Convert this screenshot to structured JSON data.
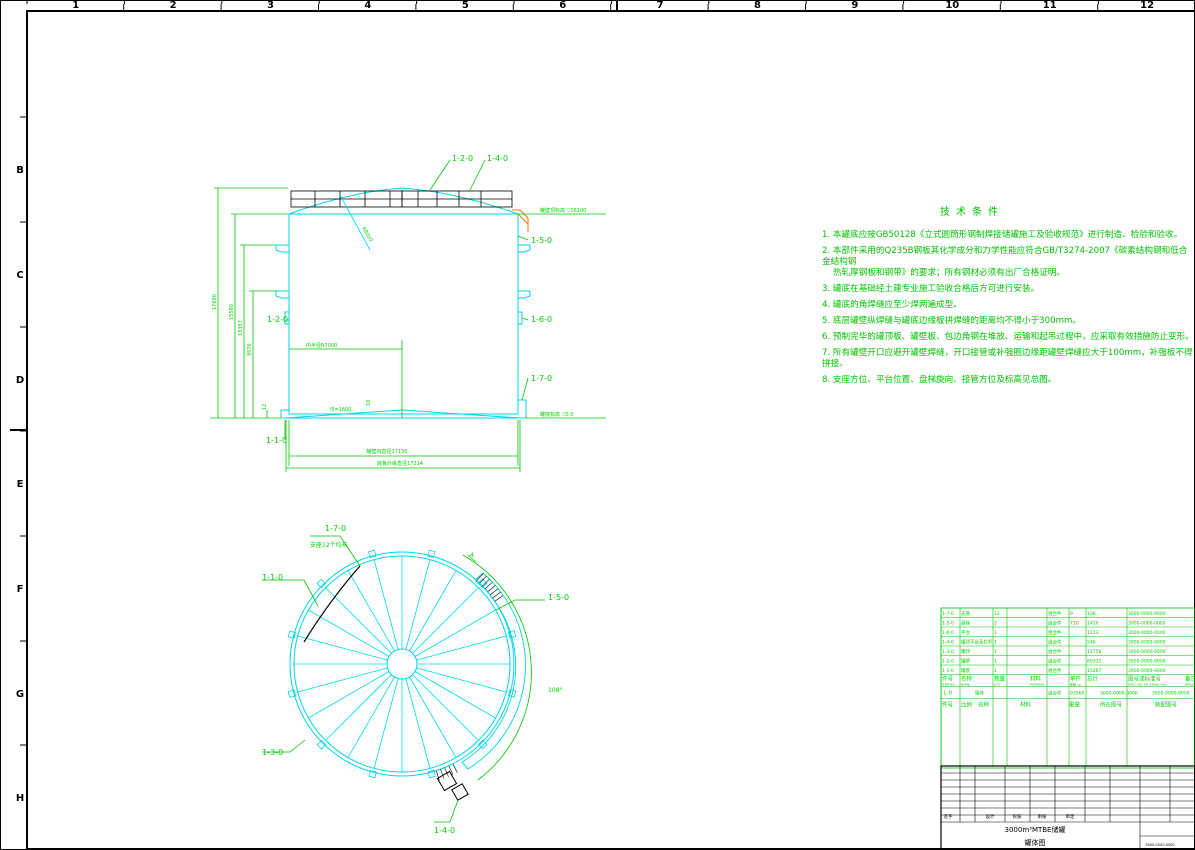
{
  "border": {
    "columns": [
      "1",
      "2",
      "3",
      "4",
      "5",
      "6",
      "7",
      "8",
      "9",
      "10",
      "11",
      "12"
    ],
    "rows": [
      "B",
      "C",
      "D",
      "E",
      "F",
      "G",
      "H"
    ]
  },
  "elevation": {
    "callouts": [
      "1-2-0",
      "1-4-0",
      "1-5-0",
      "1-2-0",
      "1-6-0",
      "1-7-0",
      "1-1-0"
    ],
    "dims": [
      "17690",
      "15580",
      "13357",
      "9576",
      "12"
    ],
    "roof_slope_label": "R8000",
    "inner_radius_label": "内半径R7000",
    "elevation_top": "罐壁顶标高 ▽16100",
    "elevation_bottom": "罐底标高 ▽0.0",
    "bottom_slope": "i5=1600",
    "bottom_slope_small": "10",
    "diameter_inner": "罐壁内直径17150",
    "diameter_outer": "底板外缘直径17214"
  },
  "plan": {
    "callouts": [
      "1-7-0",
      "1-1-0",
      "1-5-0",
      "1-3-0",
      "1-4-0"
    ],
    "lugs_label": "支座12个均布",
    "angle_label": "108°",
    "small_label": "4"
  },
  "notes": {
    "title": "技术条件",
    "items": [
      "1. 本罐底应按GB50128《立式圆筒形钢制焊接储罐施工及验收规范》进行制造、检验和验收。",
      "2. 本部件采用的Q235B钢板其化学成分和力学性能应符合GB/T3274-2007《碳素结构钢和低合金结构钢\n    热轧厚钢板和钢带》的要求；所有钢材必须有出厂合格证明。",
      "3. 罐底在基础经土建专业施工验收合格后方可进行安装。",
      "4. 罐底的角焊缝应至少焊两遍成型。",
      "5. 底层罐壁纵焊缝与罐底边缘板拼焊缝的距离均不得小于300mm。",
      "6. 预制完毕的罐顶板、罐壁板、包边角钢在堆放、运输和起吊过程中，应采取有效措施防止变形。",
      "7. 所有罐壁开口应避开罐壁焊缝，开口接管或补强圈边缘距罐壁焊缝应大于100mm，补强板不得拼接。",
      "8. 支座方位、平台位置、盘梯旋向、接管方位及标高见总图。"
    ]
  },
  "bom": {
    "rows": [
      {
        "no": "1-7-0",
        "name": "支座",
        "qty": "12",
        "mat": "组合件",
        "w1": "9",
        "w2": "108",
        "dwg": "3000-0000-0000"
      },
      {
        "no": "1-5-0",
        "name": "盘梯",
        "qty": "2",
        "mat": "组合件",
        "w1": "710",
        "w2": "1420",
        "dwg": "3000-0000-0000"
      },
      {
        "no": "1-6-0",
        "name": "平台",
        "qty": "1",
        "mat": "组合件",
        "w1": "",
        "w2": "1113",
        "dwg": "3000-0000-0000"
      },
      {
        "no": "1-4-0",
        "name": "罐顶平台及栏杆",
        "qty": "1",
        "mat": "组合件",
        "w1": "",
        "w2": "546",
        "dwg": "3000-0000-0000"
      },
      {
        "no": "1-3-0",
        "name": "罐顶",
        "qty": "1",
        "mat": "组合件",
        "w1": "",
        "w2": "13756",
        "dwg": "3000-0000-0000"
      },
      {
        "no": "1-2-0",
        "name": "罐壁",
        "qty": "1",
        "mat": "组合件",
        "w1": "",
        "w2": "60331",
        "dwg": "3000-0000-0000"
      },
      {
        "no": "1-1-0",
        "name": "罐底",
        "qty": "1",
        "mat": "组合件",
        "w1": "",
        "w2": "15267",
        "dwg": "3000-0000-0000"
      }
    ],
    "header": [
      "件号",
      "名称",
      "数量",
      "材料",
      "单件",
      "总计",
      "图号或标准号",
      "备注"
    ],
    "header2": [
      "ITEM NO.",
      "NAME",
      "QTY",
      "MATERIAL",
      "重量 kg",
      "",
      "DWG. NO. OR STAND. NO.",
      "REMARKS"
    ],
    "assembly": {
      "no": "1-0",
      "name": "罐体",
      "mat": "组合件",
      "weight": "93560",
      "dwg": "3000-0000-0000",
      "dwg2": "3000-0000-0000"
    },
    "footer_header": [
      "件号",
      "比例",
      "名称",
      "材料",
      "重量",
      "所在图号",
      "装配图号"
    ]
  },
  "titleblock": {
    "project": "3000m³MTBE储罐",
    "drawing_name": "罐体图",
    "labels": [
      "签字",
      "设计",
      "校核",
      "审核",
      "审定"
    ],
    "drawing_no": "3000-0000-0000"
  }
}
